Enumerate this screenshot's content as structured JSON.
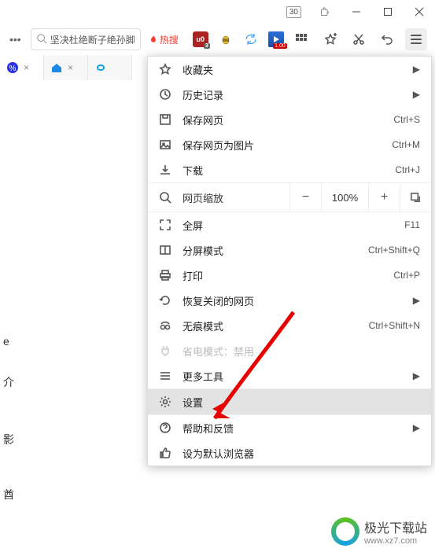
{
  "window": {
    "badge_count": "30"
  },
  "toolbar": {
    "search_text": "坚决杜绝断子绝孙脚",
    "hot_label": "热搜",
    "ublock_sub": "3",
    "play_sub": "1.00"
  },
  "menu": {
    "favorites": "收藏夹",
    "history": "历史记录",
    "save_page": "保存网页",
    "save_page_short": "Ctrl+S",
    "save_as_image": "保存网页为图片",
    "save_as_image_short": "Ctrl+M",
    "downloads": "下载",
    "downloads_short": "Ctrl+J",
    "zoom_label": "网页缩放",
    "zoom_value": "100%",
    "fullscreen": "全屏",
    "fullscreen_short": "F11",
    "split_screen": "分屏模式",
    "split_screen_short": "Ctrl+Shift+Q",
    "print": "打印",
    "print_short": "Ctrl+P",
    "restore_closed": "恢复关闭的网页",
    "incognito": "无痕模式",
    "incognito_short": "Ctrl+Shift+N",
    "power_save": "省电模式：禁用",
    "more_tools": "更多工具",
    "settings": "设置",
    "help_feedback": "帮助和反馈",
    "set_default": "设为默认浏览器"
  },
  "side_texts": {
    "t1": "e",
    "t2": "介",
    "t3": "影",
    "t4": "酋"
  },
  "watermark": {
    "name": "极光下载站",
    "url": "www.xz7.com"
  }
}
